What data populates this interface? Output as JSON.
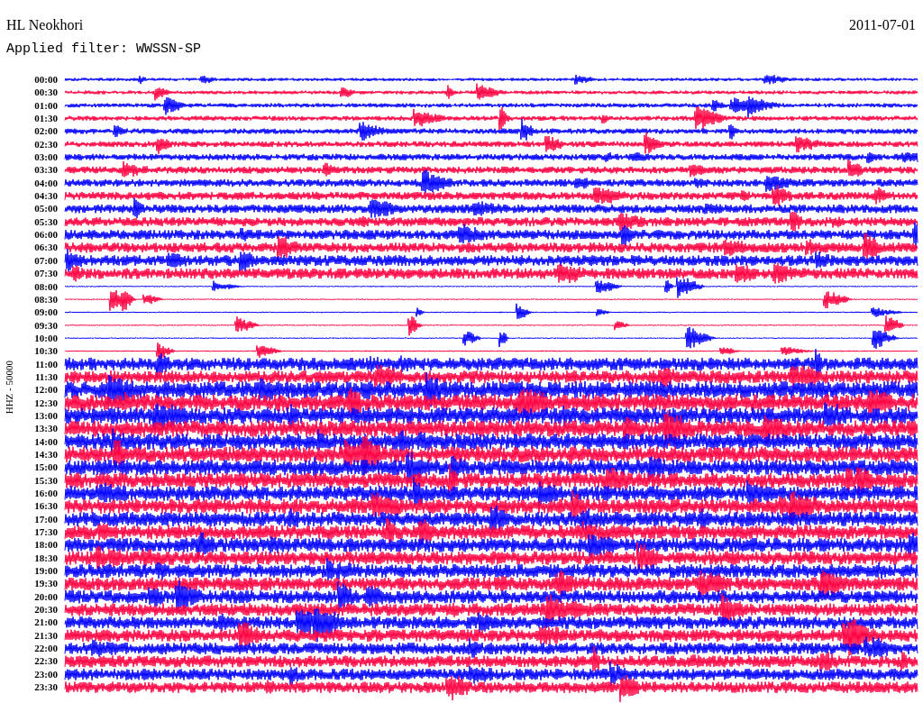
{
  "station": "HL Neokhori",
  "date": "2011-07-01",
  "filter": "Applied filter: WWSSN-SP",
  "axis_label": "HHZ - 50000",
  "rows": [
    {
      "time": "00:00",
      "color": "#0000ff"
    },
    {
      "time": "00:30",
      "color": "#ff0040"
    },
    {
      "time": "01:00",
      "color": "#0000ff"
    },
    {
      "time": "01:30",
      "color": "#ff0040"
    },
    {
      "time": "02:00",
      "color": "#0000ff"
    },
    {
      "time": "02:30",
      "color": "#ff0040"
    },
    {
      "time": "03:00",
      "color": "#0000ff"
    },
    {
      "time": "03:30",
      "color": "#ff0040"
    },
    {
      "time": "04:00",
      "color": "#0000ff"
    },
    {
      "time": "04:30",
      "color": "#ff0040"
    },
    {
      "time": "05:00",
      "color": "#0000ff"
    },
    {
      "time": "05:30",
      "color": "#ff0040"
    },
    {
      "time": "06:00",
      "color": "#0000ff"
    },
    {
      "time": "06:30",
      "color": "#ff0040"
    },
    {
      "time": "07:00",
      "color": "#0000ff"
    },
    {
      "time": "07:30",
      "color": "#ff0040"
    },
    {
      "time": "08:00",
      "color": "#0000ff"
    },
    {
      "time": "08:30",
      "color": "#ff0040"
    },
    {
      "time": "09:00",
      "color": "#0000ff"
    },
    {
      "time": "09:30",
      "color": "#ff0040"
    },
    {
      "time": "10:00",
      "color": "#0000ff"
    },
    {
      "time": "10:30",
      "color": "#ff0040"
    },
    {
      "time": "11:00",
      "color": "#0000ff"
    },
    {
      "time": "11:30",
      "color": "#ff0040"
    },
    {
      "time": "12:00",
      "color": "#0000ff"
    },
    {
      "time": "12:30",
      "color": "#ff0040"
    },
    {
      "time": "13:00",
      "color": "#0000ff"
    },
    {
      "time": "13:30",
      "color": "#ff0040"
    },
    {
      "time": "14:00",
      "color": "#0000ff"
    },
    {
      "time": "14:30",
      "color": "#ff0040"
    },
    {
      "time": "15:00",
      "color": "#0000ff"
    },
    {
      "time": "15:30",
      "color": "#ff0040"
    },
    {
      "time": "16:00",
      "color": "#0000ff"
    },
    {
      "time": "16:30",
      "color": "#ff0040"
    },
    {
      "time": "17:00",
      "color": "#0000ff"
    },
    {
      "time": "17:30",
      "color": "#ff0040"
    },
    {
      "time": "18:00",
      "color": "#0000ff"
    },
    {
      "time": "18:30",
      "color": "#ff0040"
    },
    {
      "time": "19:00",
      "color": "#0000ff"
    },
    {
      "time": "19:30",
      "color": "#ff0040"
    },
    {
      "time": "20:00",
      "color": "#0000ff"
    },
    {
      "time": "20:30",
      "color": "#ff0040"
    },
    {
      "time": "21:00",
      "color": "#0000ff"
    },
    {
      "time": "21:30",
      "color": "#ff0040"
    },
    {
      "time": "22:00",
      "color": "#0000ff"
    },
    {
      "time": "22:30",
      "color": "#ff0040"
    },
    {
      "time": "23:00",
      "color": "#0000ff"
    },
    {
      "time": "23:30",
      "color": "#ff0040"
    }
  ]
}
